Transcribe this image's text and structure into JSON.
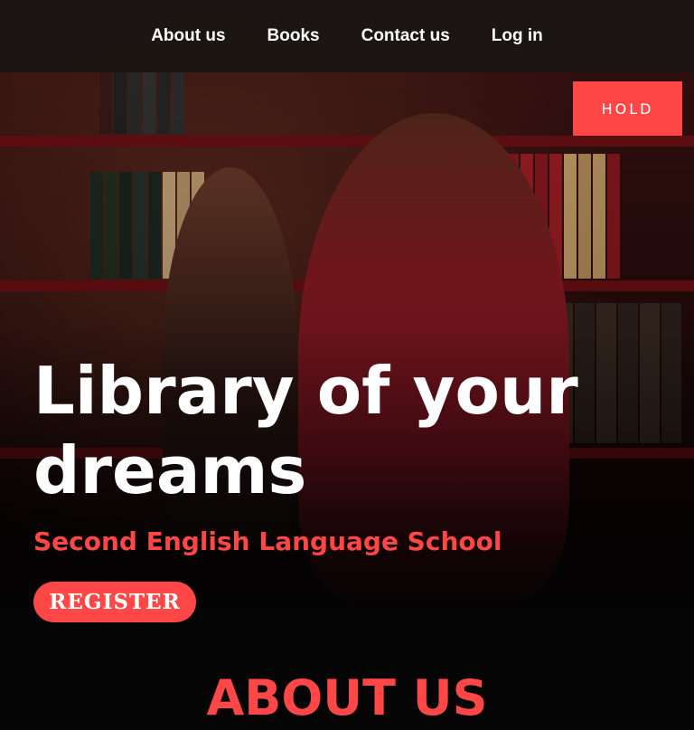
{
  "nav": {
    "items": [
      {
        "label": "About us"
      },
      {
        "label": "Books"
      },
      {
        "label": "Contact us"
      },
      {
        "label": "Log in"
      }
    ]
  },
  "hold_button": {
    "label": "HOLD"
  },
  "hero": {
    "title": "Library of your dreams",
    "subtitle": "Second English Language School",
    "register_label": "REGISTER"
  },
  "about": {
    "heading": "ABOUT US"
  },
  "colors": {
    "accent": "#ff4747",
    "nav_bg": "#191614",
    "page_bg": "#050505",
    "text_light": "#ffffff"
  }
}
